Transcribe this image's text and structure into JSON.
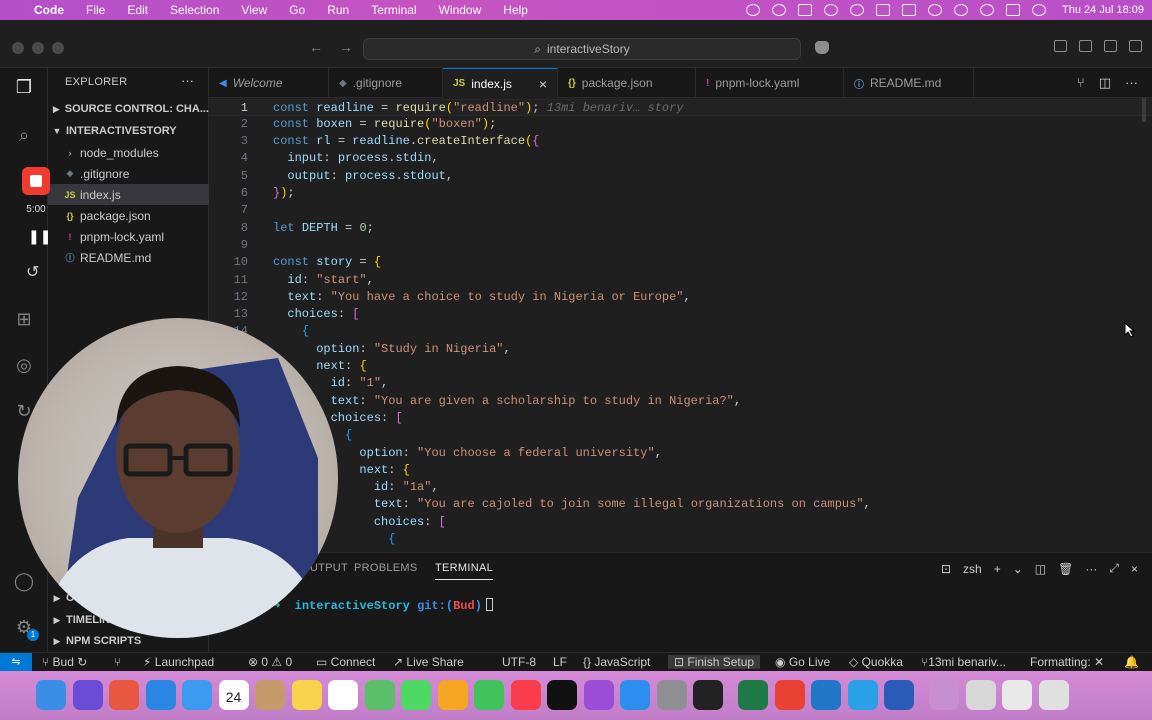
{
  "menubar": {
    "app": "Code",
    "items": [
      "File",
      "Edit",
      "Selection",
      "View",
      "Go",
      "Run",
      "Terminal",
      "Window",
      "Help"
    ],
    "clock": "Thu 24 Jul  18:09"
  },
  "titlebar": {
    "search": "interactiveStory"
  },
  "recorder": {
    "time": "5:00"
  },
  "sidebar": {
    "title": "EXPLORER",
    "source_control": "SOURCE CONTROL: CHA...",
    "project": "INTERACTIVESTORY",
    "files": [
      {
        "name": "node_modules",
        "icon": "›",
        "color": "#9d9d9d"
      },
      {
        "name": ".gitignore",
        "icon": "◆",
        "color": "#6e7681"
      },
      {
        "name": "index.js",
        "icon": "JS",
        "color": "#cbcb41"
      },
      {
        "name": "package.json",
        "icon": "{}",
        "color": "#cbcb41"
      },
      {
        "name": "pnpm-lock.yaml",
        "icon": "!",
        "color": "#d33ca4"
      },
      {
        "name": "README.md",
        "icon": "ⓘ",
        "color": "#519aba"
      }
    ],
    "bottom": [
      {
        "label": "OUTLINE"
      },
      {
        "label": "TIMELINE"
      },
      {
        "label": "NPM SCRIPTS"
      }
    ]
  },
  "tabs": [
    {
      "label": "Welcome",
      "icon": "◀",
      "color": "#3b8eea"
    },
    {
      "label": ".gitignore",
      "icon": "◆",
      "color": "#6e7681"
    },
    {
      "label": "index.js",
      "icon": "JS",
      "color": "#cbcb41"
    },
    {
      "label": "package.json",
      "icon": "{}",
      "color": "#cbcb41"
    },
    {
      "label": "pnpm-lock.yaml",
      "icon": "!",
      "color": "#d33ca4"
    },
    {
      "label": "README.md",
      "icon": "ⓘ",
      "color": "#519aba"
    }
  ],
  "editor": {
    "ghost_text": "13mi benariv… story",
    "lines": [
      [
        [
          "k",
          "const "
        ],
        [
          "v",
          "readline"
        ],
        [
          "p",
          " = "
        ],
        [
          "f",
          "require"
        ],
        [
          "b1",
          "("
        ],
        [
          "s",
          "\"readline\""
        ],
        [
          "b1",
          ")"
        ],
        [
          "p",
          ";"
        ]
      ],
      [
        [
          "k",
          "const "
        ],
        [
          "v",
          "boxen"
        ],
        [
          "p",
          " = "
        ],
        [
          "f",
          "require"
        ],
        [
          "b1",
          "("
        ],
        [
          "s",
          "\"boxen\""
        ],
        [
          "b1",
          ")"
        ],
        [
          "p",
          ";"
        ]
      ],
      [
        [
          "k",
          "const "
        ],
        [
          "v",
          "rl"
        ],
        [
          "p",
          " = "
        ],
        [
          "v",
          "readline"
        ],
        [
          "p",
          "."
        ],
        [
          "f",
          "createInterface"
        ],
        [
          "b1",
          "("
        ],
        [
          "b2",
          "{"
        ]
      ],
      [
        [
          "p",
          "  "
        ],
        [
          "v",
          "input"
        ],
        [
          "p",
          ": "
        ],
        [
          "v",
          "process"
        ],
        [
          "p",
          "."
        ],
        [
          "v",
          "stdin"
        ],
        [
          "p",
          ","
        ]
      ],
      [
        [
          "p",
          "  "
        ],
        [
          "v",
          "output"
        ],
        [
          "p",
          ": "
        ],
        [
          "v",
          "process"
        ],
        [
          "p",
          "."
        ],
        [
          "v",
          "stdout"
        ],
        [
          "p",
          ","
        ]
      ],
      [
        [
          "b2",
          "}"
        ],
        [
          "b1",
          ")"
        ],
        [
          "p",
          ";"
        ]
      ],
      [],
      [
        [
          "k",
          "let "
        ],
        [
          "v",
          "DEPTH"
        ],
        [
          "p",
          " = "
        ],
        [
          "n",
          "0"
        ],
        [
          "p",
          ";"
        ]
      ],
      [],
      [
        [
          "k",
          "const "
        ],
        [
          "v",
          "story"
        ],
        [
          "p",
          " = "
        ],
        [
          "b1",
          "{"
        ]
      ],
      [
        [
          "p",
          "  "
        ],
        [
          "v",
          "id"
        ],
        [
          "p",
          ": "
        ],
        [
          "s",
          "\"start\""
        ],
        [
          "p",
          ","
        ]
      ],
      [
        [
          "p",
          "  "
        ],
        [
          "v",
          "text"
        ],
        [
          "p",
          ": "
        ],
        [
          "s",
          "\"You have a choice to study in Nigeria or Europe\""
        ],
        [
          "p",
          ","
        ]
      ],
      [
        [
          "p",
          "  "
        ],
        [
          "v",
          "choices"
        ],
        [
          "p",
          ": "
        ],
        [
          "b2",
          "["
        ]
      ],
      [
        [
          "p",
          "    "
        ],
        [
          "b3",
          "{"
        ]
      ],
      [
        [
          "p",
          "      "
        ],
        [
          "v",
          "option"
        ],
        [
          "p",
          ": "
        ],
        [
          "s",
          "\"Study in Nigeria\""
        ],
        [
          "p",
          ","
        ]
      ],
      [
        [
          "p",
          "      "
        ],
        [
          "v",
          "next"
        ],
        [
          "p",
          ": "
        ],
        [
          "b1",
          "{"
        ]
      ],
      [
        [
          "p",
          "        "
        ],
        [
          "v",
          "id"
        ],
        [
          "p",
          ": "
        ],
        [
          "s",
          "\"1\""
        ],
        [
          "p",
          ","
        ]
      ],
      [
        [
          "p",
          "        "
        ],
        [
          "v",
          "text"
        ],
        [
          "p",
          ": "
        ],
        [
          "s",
          "\"You are given a scholarship to study in Nigeria?\""
        ],
        [
          "p",
          ","
        ]
      ],
      [
        [
          "p",
          "        "
        ],
        [
          "v",
          "choices"
        ],
        [
          "p",
          ": "
        ],
        [
          "b2",
          "["
        ]
      ],
      [
        [
          "p",
          "          "
        ],
        [
          "b3",
          "{"
        ]
      ],
      [
        [
          "p",
          "            "
        ],
        [
          "v",
          "option"
        ],
        [
          "p",
          ": "
        ],
        [
          "s",
          "\"You choose a federal university\""
        ],
        [
          "p",
          ","
        ]
      ],
      [
        [
          "p",
          "            "
        ],
        [
          "v",
          "next"
        ],
        [
          "p",
          ": "
        ],
        [
          "b1",
          "{"
        ]
      ],
      [
        [
          "p",
          "              "
        ],
        [
          "v",
          "id"
        ],
        [
          "p",
          ": "
        ],
        [
          "s",
          "\"1a\""
        ],
        [
          "p",
          ","
        ]
      ],
      [
        [
          "p",
          "              "
        ],
        [
          "v",
          "text"
        ],
        [
          "p",
          ": "
        ],
        [
          "s",
          "\"You are cajoled to join some illegal organizations on campus\""
        ],
        [
          "p",
          ","
        ]
      ],
      [
        [
          "p",
          "              "
        ],
        [
          "v",
          "choices"
        ],
        [
          "p",
          ": "
        ],
        [
          "b2",
          "["
        ]
      ],
      [
        [
          "p",
          "                "
        ],
        [
          "b3",
          "{"
        ]
      ]
    ]
  },
  "panel": {
    "tabs": [
      "OUTPUT",
      "PROBLEMS",
      "TERMINAL"
    ],
    "shell": "zsh",
    "terminal_prefix": "interactiveStory",
    "terminal_git": "git:(",
    "terminal_branch": "Bud",
    "terminal_close": ")"
  },
  "statusbar": {
    "branch": "Bud",
    "launchpad": "Launchpad",
    "errors": "0",
    "warnings": "0",
    "connect": "Connect",
    "liveshare": "Live Share",
    "encoding": "UTF-8",
    "eol": "LF",
    "language": "JavaScript",
    "finish_setup": "Finish Setup",
    "golive": "Go Live",
    "quokka": "Quokka",
    "blame": "13mi benariv...",
    "formatting": "Formatting: ✕"
  },
  "dock": {
    "calendar_day": "24",
    "apps": [
      {
        "name": "finder",
        "color": "#3a8ee6"
      },
      {
        "name": "siri",
        "color": "#6a4cd6"
      },
      {
        "name": "launchpad",
        "color": "#e8573f"
      },
      {
        "name": "safari",
        "color": "#2a86e2"
      },
      {
        "name": "mail",
        "color": "#3c9af0"
      },
      {
        "name": "calendar",
        "color": "#ffffff"
      },
      {
        "name": "contacts",
        "color": "#c69a6b"
      },
      {
        "name": "notes",
        "color": "#f7d24a"
      },
      {
        "name": "reminders",
        "color": "#ffffff"
      },
      {
        "name": "maps",
        "color": "#5bbf6a"
      },
      {
        "name": "messages",
        "color": "#4cd964"
      },
      {
        "name": "photos",
        "color": "#f5a623"
      },
      {
        "name": "facetime",
        "color": "#3fc35a"
      },
      {
        "name": "music",
        "color": "#fa3c4c"
      },
      {
        "name": "tv",
        "color": "#111111"
      },
      {
        "name": "podcasts",
        "color": "#9b4dd8"
      },
      {
        "name": "appstore",
        "color": "#2d8ef0"
      },
      {
        "name": "settings",
        "color": "#8e8e93"
      },
      {
        "name": "terminal",
        "color": "#222222"
      },
      {
        "name": "excel",
        "color": "#1d7a45"
      },
      {
        "name": "chrome",
        "color": "#e94235"
      },
      {
        "name": "vscode",
        "color": "#2276c8"
      },
      {
        "name": "vpn",
        "color": "#2aa0e8"
      },
      {
        "name": "word",
        "color": "#2b5bb8"
      },
      {
        "name": "help",
        "color": "#c88fd0"
      },
      {
        "name": "screenshot",
        "color": "#d7d7d7"
      },
      {
        "name": "folder",
        "color": "#e9e9e9"
      },
      {
        "name": "trash",
        "color": "#e0e0e0"
      }
    ]
  }
}
